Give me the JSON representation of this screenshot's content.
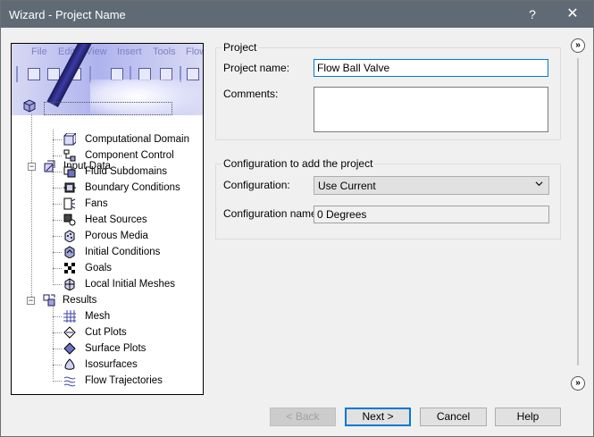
{
  "window": {
    "title": "Wizard - Project Name",
    "help_glyph": "?",
    "close_glyph": "✕"
  },
  "banner": {
    "menu": [
      "File",
      "Edit",
      "View",
      "Insert",
      "Tools",
      "Flow"
    ]
  },
  "tree": {
    "input_data": {
      "label": "Input Data",
      "children": [
        {
          "label": "Computational Domain",
          "icon": "computational-domain-icon"
        },
        {
          "label": "Component Control",
          "icon": "component-control-icon"
        },
        {
          "label": "Fluid Subdomains",
          "icon": "fluid-subdomains-icon"
        },
        {
          "label": "Boundary Conditions",
          "icon": "boundary-conditions-icon"
        },
        {
          "label": "Fans",
          "icon": "fans-icon"
        },
        {
          "label": "Heat Sources",
          "icon": "heat-sources-icon"
        },
        {
          "label": "Porous Media",
          "icon": "porous-media-icon"
        },
        {
          "label": "Initial Conditions",
          "icon": "initial-conditions-icon"
        },
        {
          "label": "Goals",
          "icon": "goals-icon"
        },
        {
          "label": "Local Initial Meshes",
          "icon": "local-initial-meshes-icon"
        }
      ]
    },
    "results": {
      "label": "Results",
      "children": [
        {
          "label": "Mesh",
          "icon": "mesh-icon"
        },
        {
          "label": "Cut Plots",
          "icon": "cut-plots-icon"
        },
        {
          "label": "Surface Plots",
          "icon": "surface-plots-icon"
        },
        {
          "label": "Isosurfaces",
          "icon": "isosurfaces-icon"
        },
        {
          "label": "Flow Trajectories",
          "icon": "flow-trajectories-icon"
        }
      ]
    }
  },
  "project": {
    "legend": "Project",
    "name_label": "Project name:",
    "name_value": "Flow Ball Valve",
    "comments_label": "Comments:",
    "comments_value": ""
  },
  "configuration": {
    "legend": "Configuration to add the project",
    "config_label": "Configuration:",
    "config_value": "Use Current",
    "config_name_label": "Configuration name:",
    "config_name_value": "0 Degrees"
  },
  "scroll": {
    "up_glyph": "»",
    "down_glyph": "»"
  },
  "buttons": {
    "back": "< Back",
    "next": "Next >",
    "cancel": "Cancel",
    "help": "Help"
  },
  "colors": {
    "titlebar": "#5f6a75",
    "focus_border": "#0078d7",
    "banner": "#aeb3ee"
  }
}
